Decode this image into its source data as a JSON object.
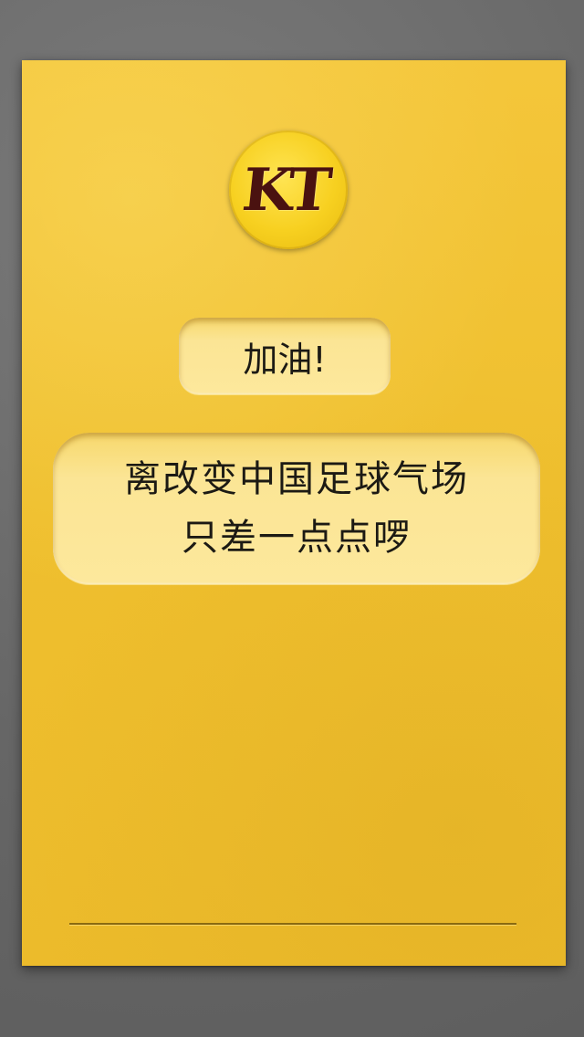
{
  "logo": {
    "text": "KT",
    "icon": "kt-logo-icon"
  },
  "messages": {
    "cheer": "加油!",
    "line1": "离改变中国足球气场",
    "line2": "只差一点点啰"
  },
  "colors": {
    "background": "#6e6e6e",
    "card": "#f1c232",
    "pill": "#fae28a",
    "logo_fill": "#f7d020",
    "logo_text": "#4a1210",
    "text": "#1c1a14"
  }
}
